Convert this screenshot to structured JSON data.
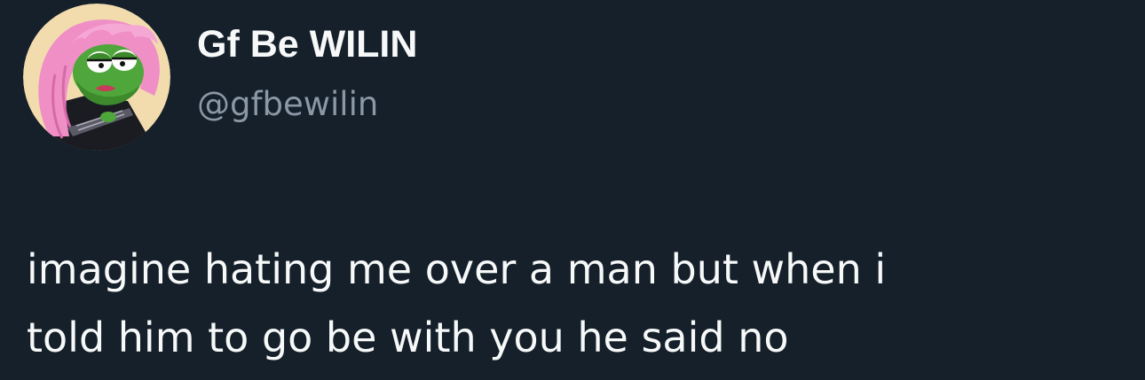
{
  "tweet": {
    "author": {
      "display_name": "Gf Be WILIN",
      "handle": "@gfbewilin",
      "avatar_icon": "cartoon-frog-girl-avatar"
    },
    "text_lines": [
      "imagine hating me over a man but when i",
      "told him to go be with you he said no"
    ]
  },
  "colors": {
    "background": "#15202b",
    "primary_text": "#f7f9f9",
    "secondary_text": "#8b98a5",
    "avatar_background": "#f2dcae"
  }
}
